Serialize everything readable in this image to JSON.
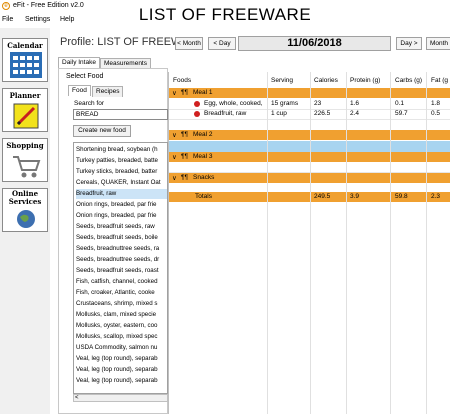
{
  "window": {
    "title": "eFit - Free Edition v2.0"
  },
  "caption": "LIST OF FREEWARE",
  "menu": [
    "File",
    "Settings",
    "Help"
  ],
  "nav": [
    {
      "label": "Calendar",
      "icon": "calendar-icon"
    },
    {
      "label": "Planner",
      "icon": "pencil-icon"
    },
    {
      "label": "Shopping",
      "icon": "shopping-cart-icon"
    },
    {
      "label": "Online Services",
      "icon": "globe-icon"
    }
  ],
  "header": {
    "profile_title": "Profile: LIST OF FREEWAR",
    "prev_month": "< Month",
    "prev_day": "< Day",
    "date": "11/06/2018",
    "next_day": "Day >",
    "next_month": "Month"
  },
  "tabs": {
    "daily": "Daily Intake",
    "measurements": "Measurements"
  },
  "select_food": {
    "label": "Select Food",
    "tab_food": "Food",
    "tab_recipes": "Recipes",
    "search_label": "Search for",
    "search_value": "BREAD",
    "create_button": "Create new food",
    "items": [
      "Shortening bread, soybean (h",
      "Turkey patties, breaded, batte",
      "Turkey sticks, breaded, batter",
      "Cereals, QUAKER, Instant Oat",
      "Breadfruit, raw",
      "Onion rings, breaded, par frie",
      "Onion rings, breaded, par frie",
      "Seeds, breadfruit seeds, raw",
      "Seeds, breadfruit seeds, boile",
      "Seeds, breadnuttree seeds, ra",
      "Seeds, breadnuttree seeds, dr",
      "Seeds, breadfruit seeds, roast",
      "Fish, catfish, channel, cooked",
      "Fish, croaker, Atlantic, cooke",
      "Crustaceans, shrimp, mixed s",
      "Mollusks, clam, mixed specie",
      "Mollusks, oyster, eastern, coo",
      "Mollusks, scallop, mixed spec",
      "USDA Commodity, salmon nu",
      "Veal, leg (top round), separab",
      "Veal, leg (top round), separab",
      "Veal, leg (top round), separab"
    ],
    "selected_index": 4
  },
  "table": {
    "headers": [
      "Foods",
      "Serving",
      "Calories",
      "Protein (g)",
      "Carbs (g)",
      "Fat (g"
    ],
    "meals": [
      {
        "name": "Meal 1",
        "rows": [
          [
            "Egg, whole, cooked,",
            "15 grams",
            "23",
            "1.6",
            "0.1",
            "1.8"
          ],
          [
            "Breadfruit, raw",
            "1 cup",
            "226.5",
            "2.4",
            "59.7",
            "0.5"
          ]
        ]
      },
      {
        "name": "Meal 2",
        "rows": []
      },
      {
        "name": "Meal 3",
        "rows": []
      },
      {
        "name": "Snacks",
        "rows": []
      }
    ],
    "totals": [
      "Totals",
      "",
      "249.5",
      "3.9",
      "59.8",
      "2.3"
    ]
  },
  "colors": {
    "meal_band": "#f0a030",
    "blue_band": "#a8d4f0",
    "selected": "#cce4f7"
  }
}
